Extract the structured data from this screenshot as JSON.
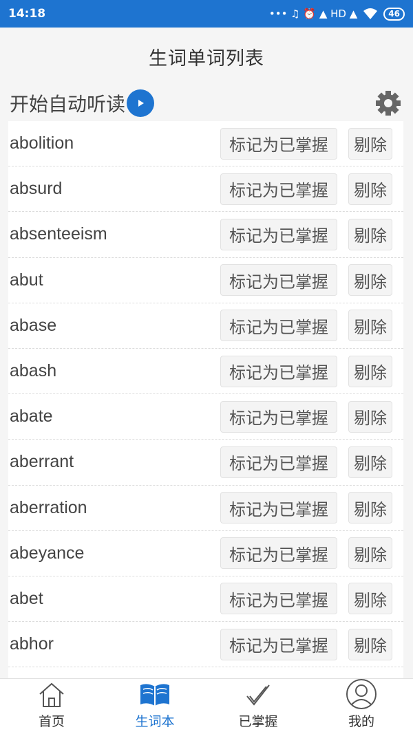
{
  "status_bar": {
    "time": "14:18",
    "icons": "••• ♫ ⏰ ▲ HD ▲",
    "battery": "46"
  },
  "header": {
    "title": "生词单词列表"
  },
  "toolbar": {
    "auto_read_label": "开始自动听读"
  },
  "words": [
    {
      "word": "abolition",
      "master_label": "标记为已掌握",
      "remove_label": "剔除"
    },
    {
      "word": "absurd",
      "master_label": "标记为已掌握",
      "remove_label": "剔除"
    },
    {
      "word": "absenteeism",
      "master_label": "标记为已掌握",
      "remove_label": "剔除"
    },
    {
      "word": "abut",
      "master_label": "标记为已掌握",
      "remove_label": "剔除"
    },
    {
      "word": "abase",
      "master_label": "标记为已掌握",
      "remove_label": "剔除"
    },
    {
      "word": "abash",
      "master_label": "标记为已掌握",
      "remove_label": "剔除"
    },
    {
      "word": "abate",
      "master_label": "标记为已掌握",
      "remove_label": "剔除"
    },
    {
      "word": "aberrant",
      "master_label": "标记为已掌握",
      "remove_label": "剔除"
    },
    {
      "word": "aberration",
      "master_label": "标记为已掌握",
      "remove_label": "剔除"
    },
    {
      "word": "abeyance",
      "master_label": "标记为已掌握",
      "remove_label": "剔除"
    },
    {
      "word": "abet",
      "master_label": "标记为已掌握",
      "remove_label": "剔除"
    },
    {
      "word": "abhor",
      "master_label": "标记为已掌握",
      "remove_label": "剔除"
    }
  ],
  "tabbar": {
    "tabs": [
      {
        "label": "首页",
        "icon": "home-icon"
      },
      {
        "label": "生词本",
        "icon": "book-icon"
      },
      {
        "label": "已掌握",
        "icon": "check-icon"
      },
      {
        "label": "我的",
        "icon": "user-icon"
      }
    ],
    "active_index": 1
  },
  "colors": {
    "accent": "#1e74d0"
  }
}
